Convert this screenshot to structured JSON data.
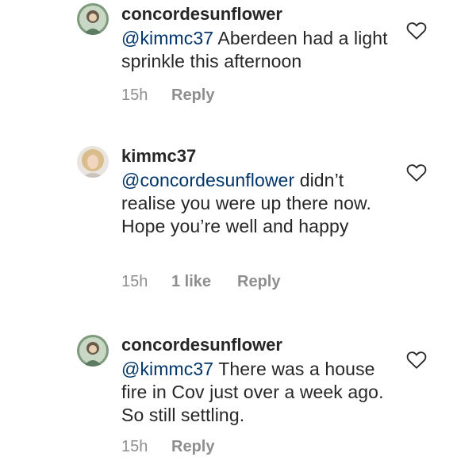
{
  "comments": [
    {
      "username": "concordesunflower",
      "mention": "@kimmc37",
      "text": " Aberdeen had a light sprinkle this afternoon",
      "time": "15h",
      "likes": "",
      "reply_label": "Reply"
    },
    {
      "username": "kimmc37",
      "mention": "@concordesunflower",
      "text": " didn’t realise you were up there now. Hope you’re well and happy",
      "time": "15h",
      "likes": "1 like",
      "reply_label": "Reply"
    },
    {
      "username": "concordesunflower",
      "mention": "@kimmc37",
      "text": " There was a house fire in Cov just over a week ago. So still settling.",
      "time": "15h",
      "likes": "",
      "reply_label": "Reply"
    }
  ],
  "icons": {
    "like": "heart-outline-icon",
    "avatar": "profile-avatar"
  },
  "colors": {
    "text": "#262626",
    "mention": "#003569",
    "secondary": "#8e8e8e"
  }
}
